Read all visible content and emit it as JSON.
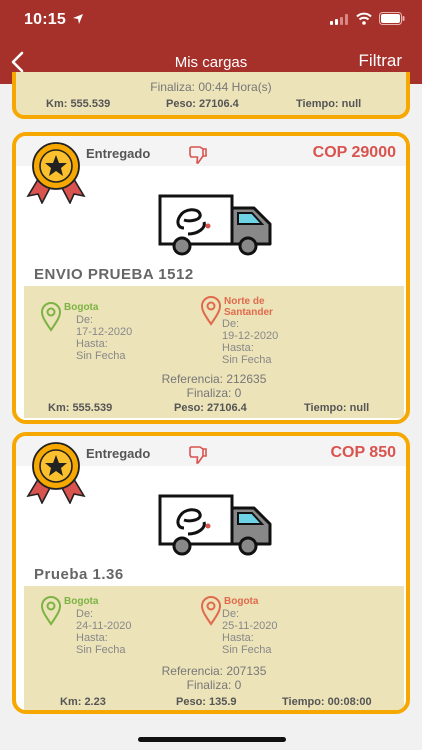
{
  "status_bar": {
    "time": "10:15"
  },
  "nav": {
    "title": "Mis cargas",
    "filter_label": "Filtrar"
  },
  "partial_card": {
    "finaliza": "Finaliza: 00:44 Hora(s)",
    "km": "Km: 555.539",
    "peso": "Peso: 27106.4",
    "tiempo": "Tiempo: null"
  },
  "cards": [
    {
      "status": "Entregado",
      "price": "COP 29000",
      "name": "ENVIO PRUEBA 1512",
      "origin": {
        "city": "Bogota",
        "de_label": "De:",
        "de": "17-12-2020",
        "hasta_label": "Hasta:",
        "hasta": "Sin Fecha"
      },
      "destination": {
        "city": "Norte de Santander",
        "de_label": "De:",
        "de": "19-12-2020",
        "hasta_label": "Hasta:",
        "hasta": "Sin Fecha"
      },
      "referencia": "Referencia: 212635",
      "finaliza": "Finaliza: 0",
      "km": "Km: 555.539",
      "peso": "Peso: 27106.4",
      "tiempo": "Tiempo: null"
    },
    {
      "status": "Entregado",
      "price": "COP 850",
      "name": "Prueba 1.36",
      "origin": {
        "city": "Bogota",
        "de_label": "De:",
        "de": "24-11-2020",
        "hasta_label": "Hasta:",
        "hasta": "Sin Fecha"
      },
      "destination": {
        "city": "Bogota",
        "de_label": "De:",
        "de": "25-11-2020",
        "hasta_label": "Hasta:",
        "hasta": "Sin Fecha"
      },
      "referencia": "Referencia: 207135",
      "finaliza": "Finaliza: 0",
      "km": "Km: 2.23",
      "peso": "Peso: 135.9",
      "tiempo": "Tiempo: 00:08:00"
    }
  ],
  "colors": {
    "header": "#a6312b",
    "card_border": "#f6a800",
    "detail_bg": "#ece3b9",
    "price": "#d9534f",
    "origin": "#7cb342",
    "destination": "#e06a4c"
  },
  "icons": [
    "location-arrow-icon",
    "signal-icon",
    "wifi-icon",
    "battery-icon",
    "back-chevron-icon",
    "medal-icon",
    "thumbs-down-icon",
    "truck-icon",
    "map-pin-icon"
  ]
}
